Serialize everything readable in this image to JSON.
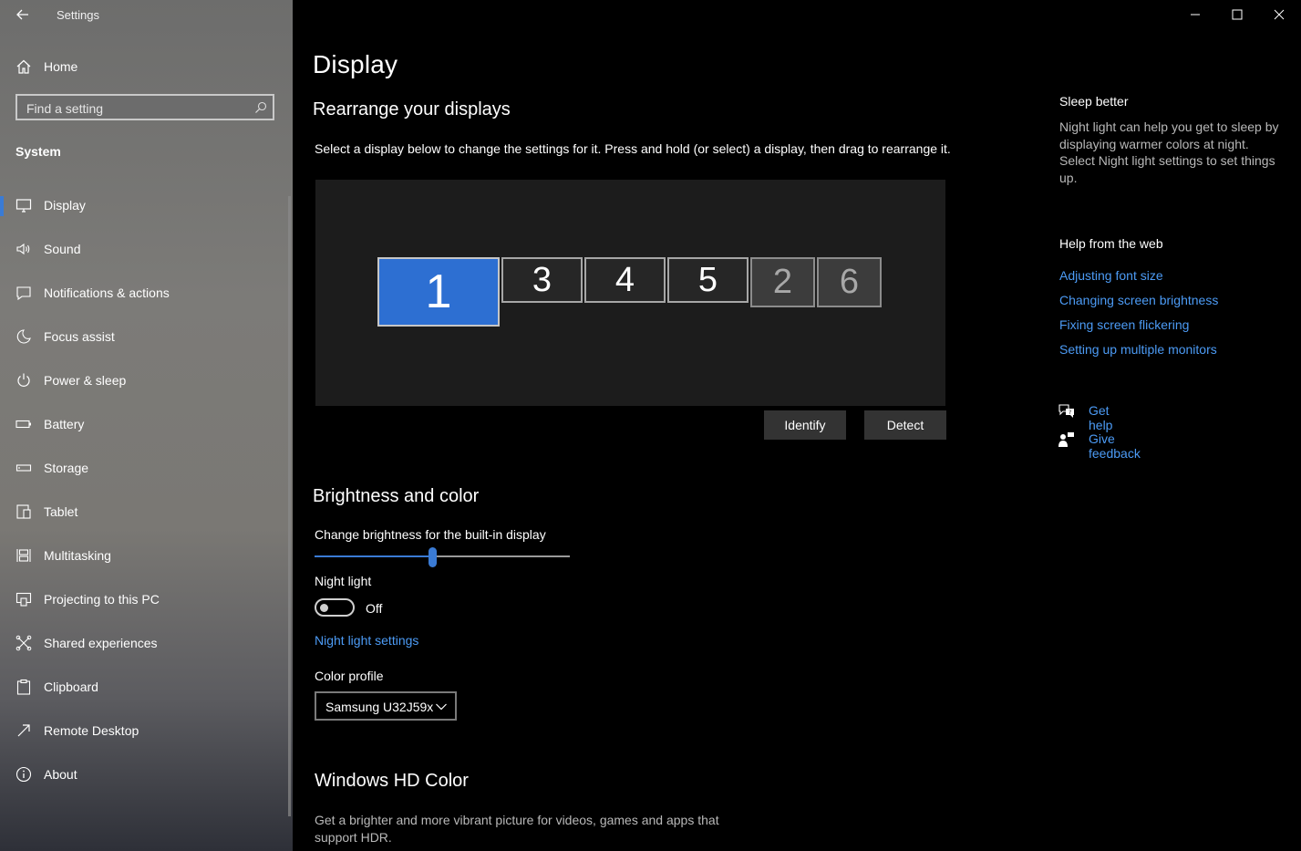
{
  "window": {
    "title": "Settings",
    "controls": {
      "minimize": "minimize-icon",
      "maximize": "maximize-icon",
      "close": "close-icon"
    }
  },
  "sidebar": {
    "home_label": "Home",
    "search_placeholder": "Find a setting",
    "section_label": "System",
    "items": [
      {
        "label": "Display",
        "icon": "display-icon",
        "active": true
      },
      {
        "label": "Sound",
        "icon": "speaker-icon"
      },
      {
        "label": "Notifications & actions",
        "icon": "notification-icon"
      },
      {
        "label": "Focus assist",
        "icon": "moon-icon"
      },
      {
        "label": "Power & sleep",
        "icon": "power-icon"
      },
      {
        "label": "Battery",
        "icon": "battery-icon"
      },
      {
        "label": "Storage",
        "icon": "storage-icon"
      },
      {
        "label": "Tablet",
        "icon": "tablet-icon"
      },
      {
        "label": "Multitasking",
        "icon": "multitasking-icon"
      },
      {
        "label": "Projecting to this PC",
        "icon": "projecting-icon"
      },
      {
        "label": "Shared experiences",
        "icon": "shared-icon"
      },
      {
        "label": "Clipboard",
        "icon": "clipboard-icon"
      },
      {
        "label": "Remote Desktop",
        "icon": "remote-desktop-icon"
      },
      {
        "label": "About",
        "icon": "info-icon"
      }
    ]
  },
  "main": {
    "title": "Display",
    "rearrange": {
      "heading": "Rearrange your displays",
      "description": "Select a display below to change the settings for it. Press and hold (or select) a display, then drag to rearrange it.",
      "monitors": [
        "1",
        "3",
        "4",
        "5",
        "2",
        "6"
      ],
      "identify_label": "Identify",
      "detect_label": "Detect"
    },
    "brightness": {
      "heading": "Brightness and color",
      "slider_label": "Change brightness for the built-in display",
      "brightness_level": 0.46,
      "night_light_label": "Night light",
      "night_light_state": "Off",
      "night_light_settings_link": "Night light settings",
      "color_profile_label": "Color profile",
      "color_profile_value": "Samsung U32J59x"
    },
    "hdr": {
      "heading": "Windows HD Color",
      "description": "Get a brighter and more vibrant picture for videos, games and apps that support HDR."
    }
  },
  "right_panel": {
    "sleep_heading": "Sleep better",
    "sleep_text": "Night light can help you get to sleep by displaying warmer colors at night. Select Night light settings to set things up.",
    "help_heading": "Help from the web",
    "help_links": [
      "Adjusting font size",
      "Changing screen brightness",
      "Fixing screen flickering",
      "Setting up multiple monitors"
    ],
    "get_help": "Get help",
    "give_feedback": "Give feedback"
  },
  "colors": {
    "accent": "#3a7bd5",
    "link": "#4c9bf5",
    "background": "#000000",
    "primary_monitor": "#2d6fd2"
  }
}
